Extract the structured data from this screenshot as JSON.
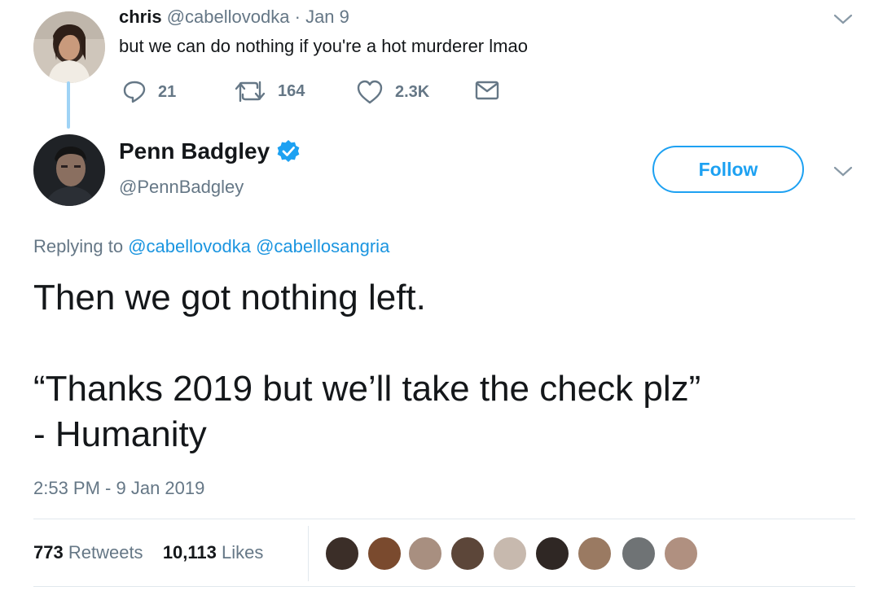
{
  "reply_parent": {
    "name": "chris",
    "handle": "@cabellovodka",
    "separator": "·",
    "date": "Jan 9",
    "text": "but we can do nothing if you're a hot murderer lmao",
    "stats": {
      "replies": "21",
      "retweets": "164",
      "likes": "2.3K"
    }
  },
  "tweet": {
    "name": "Penn Badgley",
    "handle": "@PennBadgley",
    "verified": true,
    "follow_label": "Follow",
    "replying_prefix": "Replying to",
    "replying_to": [
      "@cabellovodka",
      "@cabellosangria"
    ],
    "text": "Then we got nothing left.\n\n“Thanks 2019 but we’ll take the check plz”\n - Humanity",
    "timestamp": "2:53 PM - 9 Jan 2019",
    "retweet_count": "773",
    "retweet_label": "Retweets",
    "like_count": "10,113",
    "like_label": "Likes"
  },
  "colors": {
    "accent": "#1da1f2",
    "link": "#1b95e0",
    "muted": "#657786",
    "text": "#14171a",
    "thread_line": "#9fd3f5"
  },
  "icons": [
    "reply-icon",
    "retweet-icon",
    "like-icon",
    "dm-icon",
    "chevron-down-icon",
    "verified-badge-icon"
  ]
}
